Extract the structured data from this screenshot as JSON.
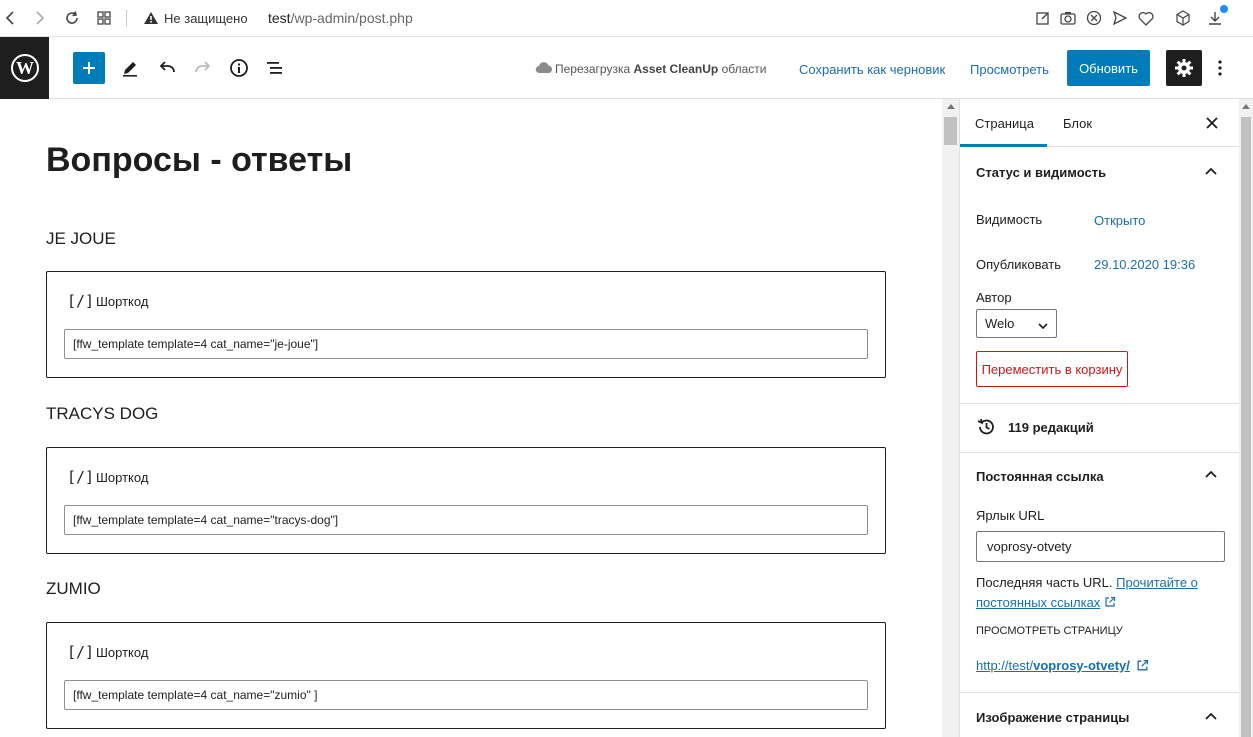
{
  "browser": {
    "insecure_label": "Не защищено",
    "url_host": "test",
    "url_path": "/wp-admin/post.php"
  },
  "toolbar": {
    "cloud_prefix": "Перезагрузка",
    "cloud_plugin": "Asset CleanUp",
    "cloud_suffix": "области",
    "save_draft_label": "Сохранить как черновик",
    "preview_label": "Просмотреть",
    "update_label": "Обновить"
  },
  "post": {
    "title": "Вопросы - ответы",
    "sections": [
      {
        "heading": "JE JOUE",
        "block_icon": "[/]",
        "block_label": "Шорткод",
        "shortcode": "[ffw_template template=4 cat_name=\"je-joue\"]"
      },
      {
        "heading": "TRACYS DOG",
        "block_icon": "[/]",
        "block_label": "Шорткод",
        "shortcode": "[ffw_template template=4 cat_name=\"tracys-dog\"]"
      },
      {
        "heading": "ZUMIO",
        "block_icon": "[/]",
        "block_label": "Шорткод",
        "shortcode": "[ffw_template template=4 cat_name=\"zumio\" ]"
      }
    ]
  },
  "sidebar": {
    "tabs": [
      {
        "label": "Страница",
        "active": true
      },
      {
        "label": "Блок",
        "active": false
      }
    ],
    "status_panel": {
      "title": "Статус и видимость",
      "visibility_label": "Видимость",
      "visibility_value": "Открыто",
      "published_label": "Опубликовать",
      "published_value": "29.10.2020 19:36",
      "author_label": "Автор",
      "author_value": "Welo",
      "trash_label": "Переместить в корзину"
    },
    "revisions_label": "119 редакций",
    "permalink_panel": {
      "title": "Постоянная ссылка",
      "slug_label": "Ярлык URL",
      "slug_value": "voprosy-otvety",
      "help_text": "Последняя часть URL.",
      "help_link_1": "Прочитайте о",
      "help_link_2": "постоянных ссылках",
      "view_page_label": "Просмотреть страницу",
      "url_prefix": "http://test/",
      "url_slug": "voprosy-otvety/"
    },
    "featured_image_panel": {
      "title": "Изображение страницы"
    }
  },
  "colors": {
    "accent": "#007cba",
    "link": "#1a6fa8",
    "danger": "#cc1818",
    "dark": "#1e1e1e"
  }
}
